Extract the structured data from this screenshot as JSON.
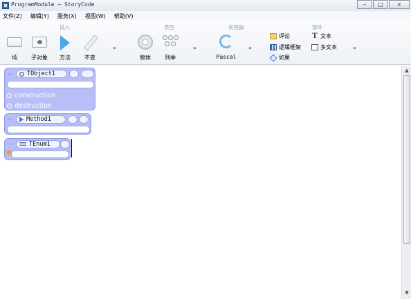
{
  "window": {
    "title": "ProgramModule — StoryCode",
    "buttons": {
      "minimize": "–",
      "maximize": "□",
      "close": "×"
    }
  },
  "menu": [
    "文件(Z)",
    "编辑(Y)",
    "服务(X)",
    "视图(W)",
    "帮助(V)"
  ],
  "ribbon": {
    "groups": {
      "insert": "插入",
      "type": "类型",
      "processor": "处理器",
      "parts": "部外"
    },
    "insert_buttons": [
      "场",
      "子对象",
      "方法",
      "不变"
    ],
    "type_buttons": [
      "物体",
      "列举"
    ],
    "processor_button": "Pascal",
    "parts_items": {
      "comment": "评论",
      "text": "文本",
      "logic_frame": "逻辑框架",
      "multi_text": "多文本",
      "if": "如果"
    },
    "more": "»"
  },
  "canvas": {
    "object_block": {
      "name": "TObject1",
      "sections": [
        "construction",
        "destruction"
      ]
    },
    "method_block": {
      "name": "Method1"
    },
    "enum_block": {
      "name": "TEnum1"
    }
  },
  "icons": {
    "field": "field-icon",
    "child_object": "child-object-icon",
    "method": "method-icon",
    "invariant": "invariant-icon",
    "object": "object-icon",
    "enumeration": "enumeration-icon",
    "pascal": "refresh-icon",
    "comment": "folder-icon",
    "text": "text-t-icon",
    "logic_frame": "logic-frame-icon",
    "multi_text": "multi-text-icon",
    "if": "if-icon"
  },
  "colors": {
    "block_fill": "#b8bff7",
    "block_border": "#8f98e6",
    "method_icon": "#4aa8e8"
  }
}
